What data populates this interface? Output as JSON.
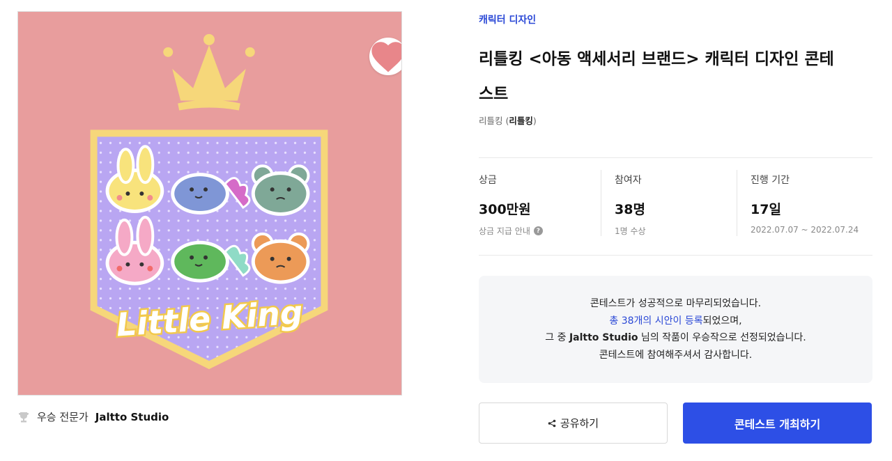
{
  "image": {
    "logo_text": "Little King"
  },
  "winner": {
    "prefix": "우승 전문가",
    "name": "Jaltto Studio"
  },
  "contest": {
    "category": "캐릭터 디자인",
    "title": "리틀킹 <아동 액세서리 브랜드> 캐릭터 디자인 콘테스트",
    "host_prefix": "리틀킹 (",
    "host_name": "리틀킹",
    "host_suffix": ")"
  },
  "stats": [
    {
      "label": "상금",
      "value": "300만원",
      "sub": "상금 지급 안내"
    },
    {
      "label": "참여자",
      "value": "38명",
      "sub": "1명 수상"
    },
    {
      "label": "진행 기간",
      "value": "17일",
      "sub": "2022.07.07 ~ 2022.07.24"
    }
  ],
  "notice": {
    "line1": "콘테스트가 성공적으로 마무리되었습니다.",
    "line2_link": "총 38개의 시안이 등록",
    "line2_rest": "되었으며,",
    "line3_pre": "그 중 ",
    "line3_name": "Jaltto Studio",
    "line3_rest": " 님의 작품이 우승작으로 선정되었습니다.",
    "line4": "콘테스트에 참여해주셔서 감사합니다."
  },
  "buttons": {
    "share": "공유하기",
    "host": "콘테스트 개최하기"
  },
  "colors": {
    "accent": "#2d4fe6",
    "link": "#2a48d6",
    "image_bg": "#e89d9d",
    "badge": "#b9a6f2"
  }
}
